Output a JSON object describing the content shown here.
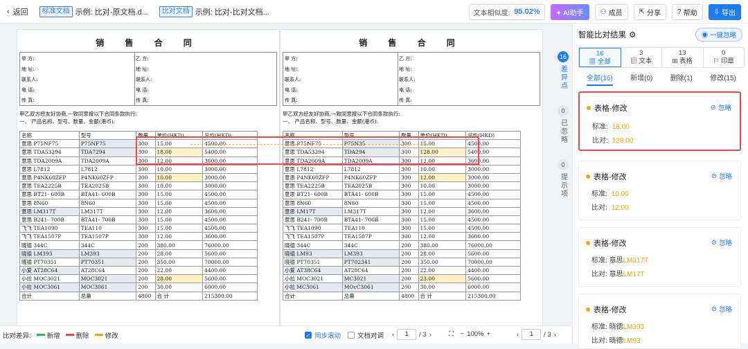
{
  "topbar": {
    "back_label": "返回",
    "std_tag": "标准文档",
    "std_name": "示例: 比对-原文档.d...",
    "cmp_tag": "比对文档",
    "cmp_name": "示例: 比对-比对文档...",
    "similarity_label": "文本相似度:",
    "similarity_value": "95.02%",
    "ai_label": "AI助手",
    "member_label": "成员",
    "share_label": "分享",
    "help_label": "帮助",
    "export_label": "导出"
  },
  "doc": {
    "title": "销 售 合 同",
    "info_left": [
      "甲 方:",
      "地 址:",
      "联系人:",
      "电 话:",
      "传 真:"
    ],
    "info_right": [
      "乙 方:",
      "地 址:",
      "联系人:",
      "电 话:",
      "传 真:"
    ],
    "sentence": "甲乙双方经友好协商,一致同意按以下合同条款执行:",
    "section": "一、 产品名称、型号、数量、金额(港币):",
    "headers": [
      "名称",
      "型号",
      "数量",
      "单价(HKD)",
      "总价(HKD)"
    ]
  },
  "doc1_rows": [
    [
      "意思 P75NF75",
      "P75NF75",
      "300",
      "15.00",
      "4500.00"
    ],
    [
      "意思 TDA53294",
      "TDA7294",
      "300",
      "18.00",
      "5400.00"
    ],
    [
      "意思 TDA2009A",
      "TDA2009A",
      "300",
      "12.00",
      "3600.00"
    ],
    [
      "意思 L7812",
      "L7812",
      "300",
      "10.00",
      "3000.00"
    ],
    [
      "意思 P4NK60ZFP",
      "P4NK60ZFP",
      "300",
      "10.00",
      "3000.00"
    ],
    [
      "意思 TEA2225B",
      "TEA2025B",
      "300",
      "10.00",
      "3000.00"
    ],
    [
      "意思 BT21- 600B",
      "BTA41- 600B",
      "300",
      "15.00",
      "4500.00"
    ],
    [
      "意思 8N60",
      "8N60",
      "300",
      "15.00",
      "4500.00"
    ],
    [
      "意思 LM317T",
      "LM317T",
      "300",
      "12.00",
      "3600.00"
    ],
    [
      "意思 B241- 700B",
      "BTA41- 700B",
      "300",
      "15.00",
      "4500.00"
    ],
    [
      "飞飞 TEA1090",
      "TEA110",
      "300",
      "15.00",
      "4500.00"
    ],
    [
      "飞飞 TEA1507P",
      "TEA1507P",
      "300",
      "12.00",
      "3600.00"
    ],
    [
      "晓德 344C",
      "344C",
      "200",
      "380.00",
      "76000.00"
    ],
    [
      "晓德 LM393",
      "LM393",
      "200",
      "28.00",
      "5600.00"
    ],
    [
      "晓德 PT70351",
      "PT70351",
      "200",
      "350.00",
      "70000.00"
    ],
    [
      "小爱 AT28C64",
      "AT28C64",
      "200",
      "22.00",
      "4400.00"
    ],
    [
      "小拉 MOC3021",
      "MOC3021",
      "200",
      "28.00",
      "5600.00"
    ],
    [
      "小拉 MOC3061",
      "MOC3061",
      "200",
      "30.00",
      "6000.00"
    ],
    [
      "合计",
      "总量",
      "4800",
      "合 计",
      "215300.00"
    ]
  ],
  "doc2_rows": [
    [
      "意思 P75NF75",
      "P75N35",
      "300",
      "15.00",
      "4500.00"
    ],
    [
      "意思 TDA53294",
      "TDA294",
      "300",
      "128.00",
      "5400.00"
    ],
    [
      "意思 TDA2009A",
      "TDA2009A",
      "300",
      "12.00",
      "3600.00"
    ],
    [
      "意思 L7812",
      "L7812",
      "300",
      "10.00",
      "3000.00"
    ],
    [
      "意思 P4NK60ZFP",
      "P4NK60ZFP",
      "300",
      "12.00",
      "3000.00"
    ],
    [
      "意思 TEA2225B",
      "TEA2025B",
      "300",
      "10.00",
      "3000.00"
    ],
    [
      "意思 BT21- 600B",
      "BTA41- 600B",
      "300",
      "15.00",
      "4500.00"
    ],
    [
      "意思 8N60",
      "8N60",
      "300",
      "15.00",
      "4500.00"
    ],
    [
      "意思 LM17T",
      "LM317T",
      "300",
      "12.00",
      "3600.00"
    ],
    [
      "意思 B241- 700B",
      "BTA41- 700B",
      "300",
      "15.00",
      "4500.00"
    ],
    [
      "飞飞 TEA1090",
      "TEA110",
      "300",
      "15.00",
      "4500.00"
    ],
    [
      "飞飞 TEA1507P",
      "TEA1507P",
      "300",
      "12.00",
      "3600.00"
    ],
    [
      "晓德 344C",
      "344C",
      "200",
      "380.00",
      "76000.00"
    ],
    [
      "晓德 LM93",
      "LM393",
      "200",
      "28.00",
      "5600.00"
    ],
    [
      "晓德 PT70351",
      "PT702341",
      "200",
      "350.00",
      "70000.00"
    ],
    [
      "小爱 AT38C64",
      "AT28C64",
      "200",
      "22.00",
      "4400.00"
    ],
    [
      "小拉 MOC3021",
      "MC3021",
      "200",
      "23.00",
      "5600.00"
    ],
    [
      "小拉 MC3061",
      "MOcC3061",
      "200",
      "30.00",
      "6000.00"
    ],
    [
      "合计",
      "总量",
      "4800",
      "合 计",
      "215300.00"
    ]
  ],
  "nav": {
    "diff_count": "16",
    "diff_label": "差异点",
    "ignored_count": "0",
    "ignored_label": "已忽略",
    "hint_count": "0",
    "hint_label": "提示项"
  },
  "panel": {
    "title": "智能比对结果",
    "ignore_all": "一键忽略",
    "cats": [
      {
        "count": "16",
        "label": "全部"
      },
      {
        "count": "3",
        "label": "文本"
      },
      {
        "count": "13",
        "label": "表格"
      },
      {
        "count": "0",
        "label": "印章"
      }
    ],
    "subtabs": [
      "全部(16)",
      "新增(0)",
      "删除(1)",
      "修改(15)"
    ],
    "cards": [
      {
        "title": "表格-修改",
        "ignore": "忽略",
        "std_label": "标准:",
        "std_prefix": "",
        "std_value": "18.00",
        "cmp_label": "比对:",
        "cmp_prefix": "",
        "cmp_value": "128.00"
      },
      {
        "title": "表格-修改",
        "ignore": "忽略",
        "std_label": "标准:",
        "std_prefix": "",
        "std_value": "10.00",
        "cmp_label": "比对:",
        "cmp_prefix": "",
        "cmp_value": "12.00"
      },
      {
        "title": "表格-修改",
        "ignore": "忽略",
        "std_label": "标准:",
        "std_prefix": "意思",
        "std_value": "LM317T",
        "cmp_label": "比对:",
        "cmp_prefix": "意思",
        "cmp_value": "LM17T"
      },
      {
        "title": "表格-修改",
        "ignore": "忽略",
        "std_label": "标准:",
        "std_prefix": "晓德",
        "std_value": "LM393",
        "cmp_label": "比对:",
        "cmp_prefix": "晓德",
        "cmp_value": "LM93"
      }
    ]
  },
  "bottombar": {
    "legend_label": "比对差异:",
    "added": "新增",
    "deleted": "删除",
    "modified": "修改",
    "sync_scroll": "同步滚动",
    "doc_align": "文档对调",
    "page_left": "1",
    "page_left_total": "/ 3",
    "zoom": "100%",
    "page_right": "1",
    "page_right_total": "/ 3"
  },
  "colors": {
    "accent": "#1f7bf2",
    "highlight": "#e5484d",
    "modified": "#e8a814",
    "added": "#3bb54a",
    "deleted": "#e5484d"
  }
}
